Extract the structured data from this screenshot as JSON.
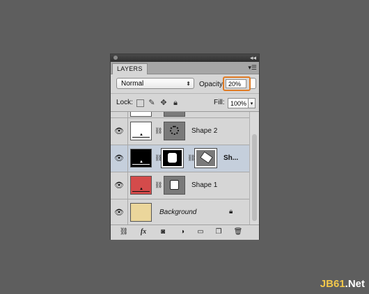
{
  "panel": {
    "tab_label": "LAYERS",
    "menu_glyph": "▾☰",
    "collapse_glyph": "◂◂",
    "blend_mode": "Normal",
    "opacity_label": "Opacity:",
    "opacity_value": "20%",
    "lock_label": "Lock:",
    "fill_label": "Fill:",
    "fill_value": "100%"
  },
  "layers": [
    {
      "name": "Shape 2",
      "thumb_color": "#ffffff",
      "mask": "circle-dots",
      "selected": false
    },
    {
      "name": "Sh...",
      "thumb_color": "#000000",
      "mask": "rounded-square",
      "vector_mask": true,
      "selected": true
    },
    {
      "name": "Shape 1",
      "thumb_color": "#d44b4b",
      "mask": "square",
      "selected": false
    },
    {
      "name": "Background",
      "thumb_color": "#ebd69b",
      "mask": null,
      "selected": false,
      "locked": true
    }
  ],
  "colors": {
    "highlight": "#e07b24",
    "selected_row": "#c5cfdc"
  },
  "watermark": {
    "prefix": "JB61",
    "suffix": ".Net"
  }
}
